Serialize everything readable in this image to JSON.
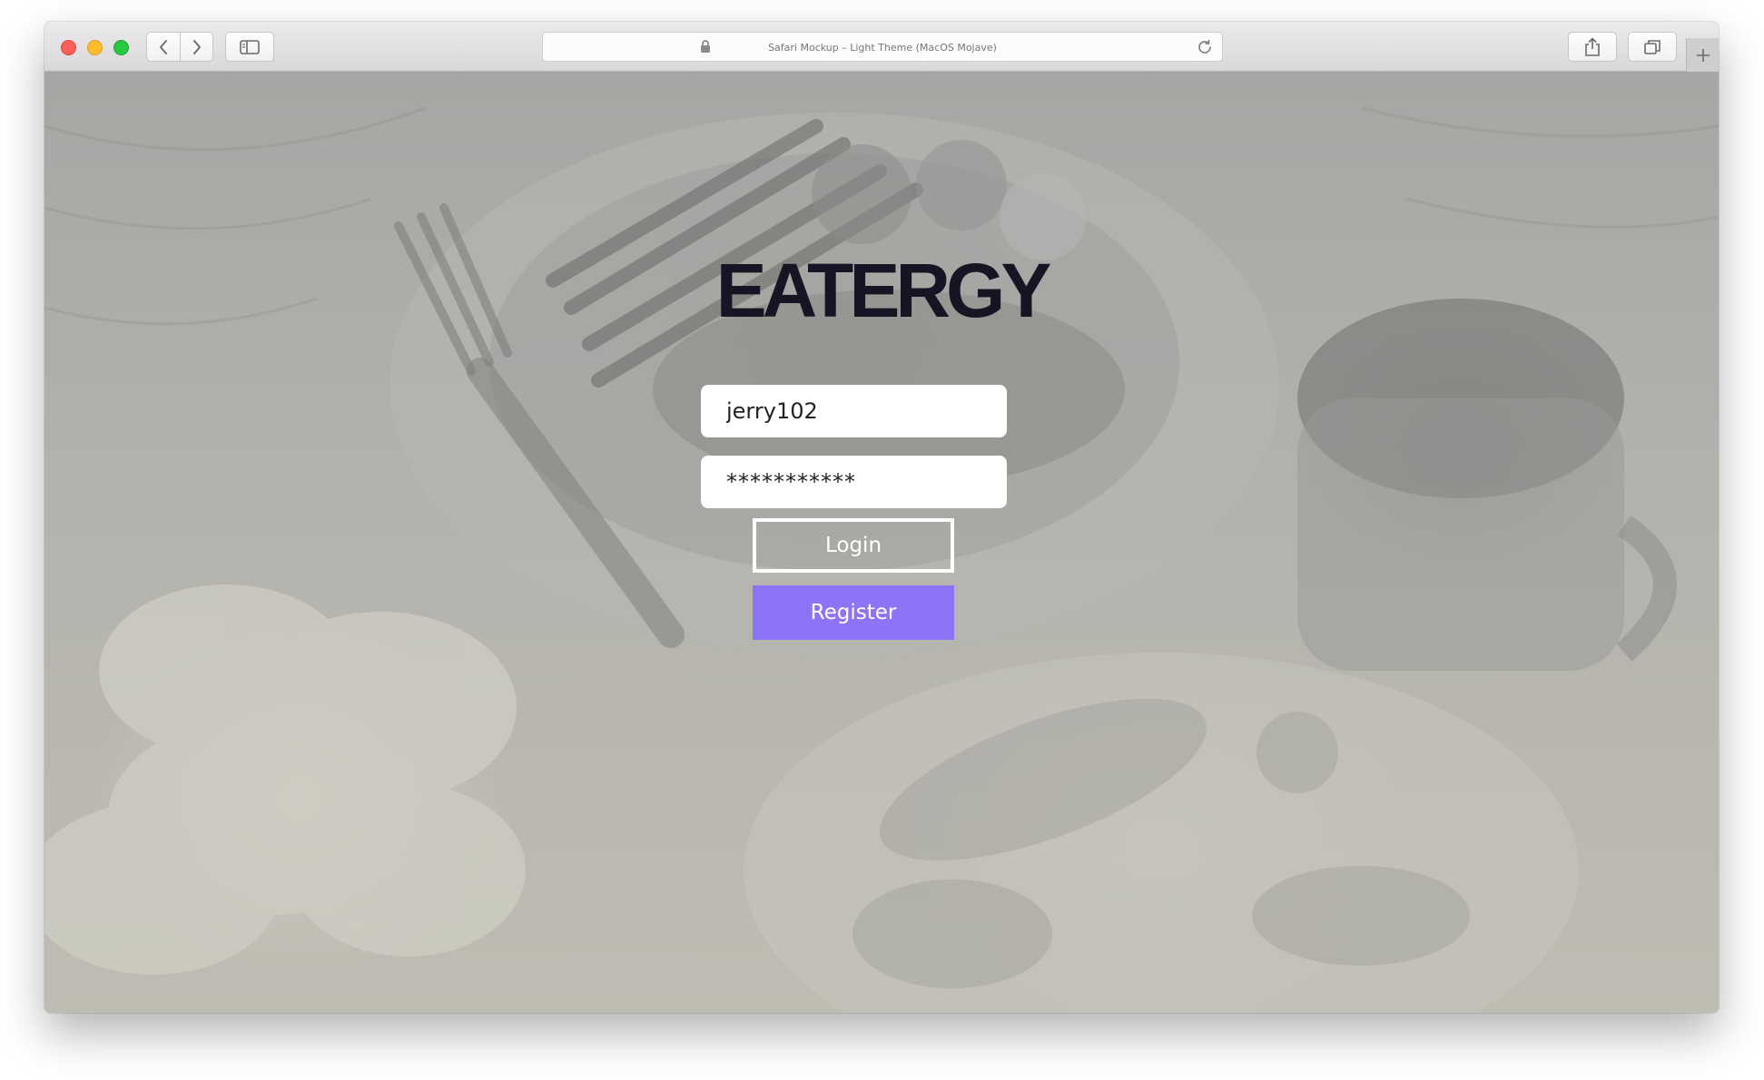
{
  "window": {
    "title": "Safari Mockup – Light Theme (MacOS Mojave)"
  },
  "toolbar": {
    "icons": {
      "close": "close-traffic-light",
      "minimize": "minimize-traffic-light",
      "zoom": "zoom-traffic-light",
      "back": "chevron-left-icon",
      "forward": "chevron-right-icon",
      "sidebar": "sidebar-icon",
      "lock": "lock-icon",
      "reload": "reload-icon",
      "share": "share-icon",
      "tabs": "tabs-overview-icon",
      "new_tab": "plus-icon"
    }
  },
  "page": {
    "brand": "EATERGY",
    "username_value": "jerry102",
    "password_value": "***********",
    "login_label": "Login",
    "register_label": "Register"
  },
  "colors": {
    "brand": "#171524",
    "accent": "#8f73f7",
    "login_border": "#ffffff"
  }
}
